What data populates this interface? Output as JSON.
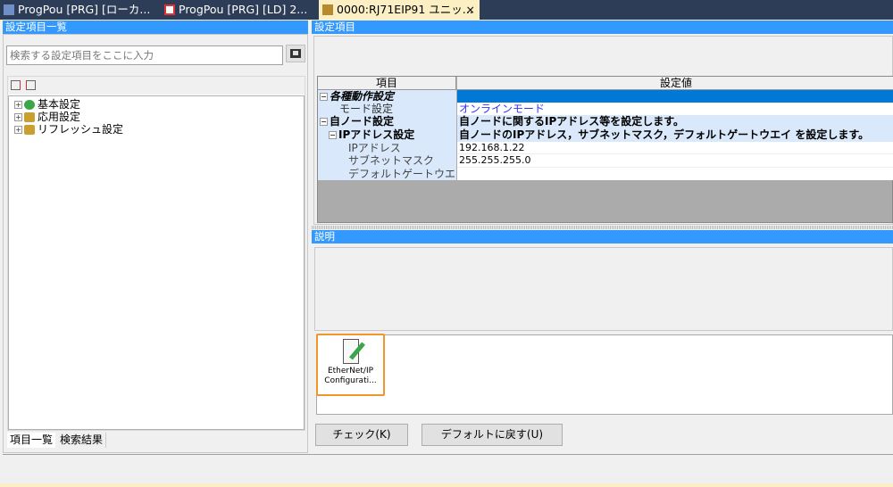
{
  "tabs": [
    {
      "label": "ProgPou [PRG] [ローカ...",
      "icon": "local-label-icon"
    },
    {
      "label": "ProgPou [PRG] [LD] 2...",
      "icon": "ladder-icon"
    },
    {
      "label": "0000:RJ71EIP91 ユニッ...",
      "icon": "module-icon",
      "active": true,
      "close": "×"
    }
  ],
  "left": {
    "title": "設定項目一覧",
    "search_placeholder": "検索する設定項目をここに入力",
    "tree": [
      "基本設定",
      "応用設定",
      "リフレッシュ設定"
    ],
    "bottom_tabs": [
      "項目一覧",
      "検索結果"
    ]
  },
  "right": {
    "title": "設定項目",
    "grid": {
      "headers": [
        "項目",
        "設定値"
      ],
      "rows": [
        {
          "item": "各種動作設定",
          "value": "",
          "level": 0,
          "style": "group-italic"
        },
        {
          "item": "モード設定",
          "value": "オンラインモード",
          "level": 1
        },
        {
          "item": "自ノード設定",
          "value": "自ノードに関するIPアドレス等を設定します。",
          "level": 0,
          "style": "group"
        },
        {
          "item": "IPアドレス設定",
          "value": "自ノードのIPアドレス，サブネットマスク，デフォルトゲートウエイ を設定します。",
          "level": 1,
          "style": "group"
        },
        {
          "item": "IPアドレス",
          "value": "192.168.1.22",
          "level": 2
        },
        {
          "item": "サブネットマスク",
          "value": "255.255.255.0",
          "level": 2
        },
        {
          "item": "デフォルトゲートウエイ",
          "value": "",
          "level": 2
        }
      ]
    },
    "description_title": "説明",
    "tool": {
      "line1": "EtherNet/IP",
      "line2": "Configurati..."
    },
    "buttons": {
      "check": "チェック(K)",
      "default": "デフォルトに戻す(U)"
    }
  },
  "colors": {
    "header": "#3399ff",
    "selected": "#0078d7",
    "link": "#3333ff",
    "tool_border": "#f0962a"
  }
}
